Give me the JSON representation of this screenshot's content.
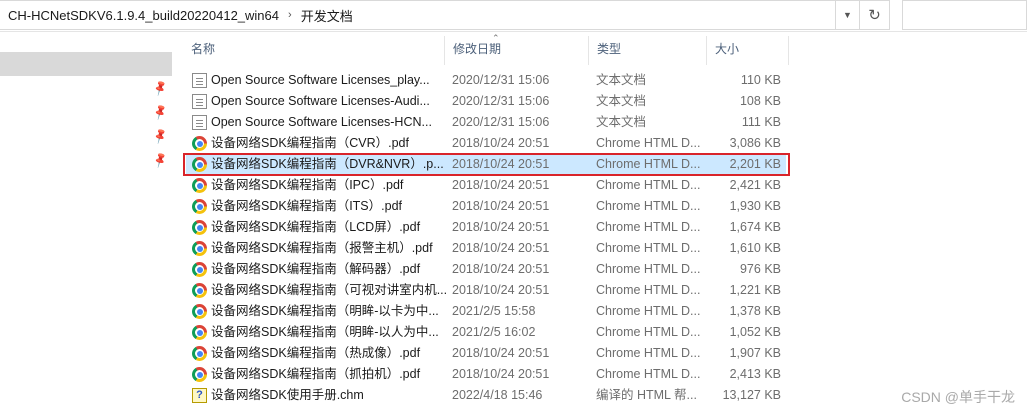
{
  "address": {
    "crumbs": [
      "CH-HCNetSDKV6.1.9.4_build20220412_win64",
      "开发文档"
    ],
    "separator": "›",
    "dropdown_icon": "chevron-down-icon",
    "refresh_icon": "refresh-icon"
  },
  "columns": {
    "name": "名称",
    "date": "修改日期",
    "type": "类型",
    "size": "大小"
  },
  "files": [
    {
      "name": "Open Source Software Licenses_play...",
      "date": "2020/12/31 15:06",
      "type": "文本文档",
      "size": "110 KB",
      "icon": "document-icon"
    },
    {
      "name": "Open Source Software Licenses-Audi...",
      "date": "2020/12/31 15:06",
      "type": "文本文档",
      "size": "108 KB",
      "icon": "document-icon"
    },
    {
      "name": "Open Source Software Licenses-HCN...",
      "date": "2020/12/31 15:06",
      "type": "文本文档",
      "size": "111 KB",
      "icon": "document-icon"
    },
    {
      "name": "设备网络SDK编程指南（CVR）.pdf",
      "date": "2018/10/24 20:51",
      "type": "Chrome HTML D...",
      "size": "3,086 KB",
      "icon": "chrome-icon"
    },
    {
      "name": "设备网络SDK编程指南（DVR&NVR）.p...",
      "date": "2018/10/24 20:51",
      "type": "Chrome HTML D...",
      "size": "2,201 KB",
      "icon": "chrome-icon",
      "selected": true
    },
    {
      "name": "设备网络SDK编程指南（IPC）.pdf",
      "date": "2018/10/24 20:51",
      "type": "Chrome HTML D...",
      "size": "2,421 KB",
      "icon": "chrome-icon"
    },
    {
      "name": "设备网络SDK编程指南（ITS）.pdf",
      "date": "2018/10/24 20:51",
      "type": "Chrome HTML D...",
      "size": "1,930 KB",
      "icon": "chrome-icon"
    },
    {
      "name": "设备网络SDK编程指南（LCD屏）.pdf",
      "date": "2018/10/24 20:51",
      "type": "Chrome HTML D...",
      "size": "1,674 KB",
      "icon": "chrome-icon"
    },
    {
      "name": "设备网络SDK编程指南（报警主机）.pdf",
      "date": "2018/10/24 20:51",
      "type": "Chrome HTML D...",
      "size": "1,610 KB",
      "icon": "chrome-icon"
    },
    {
      "name": "设备网络SDK编程指南（解码器）.pdf",
      "date": "2018/10/24 20:51",
      "type": "Chrome HTML D...",
      "size": "976 KB",
      "icon": "chrome-icon"
    },
    {
      "name": "设备网络SDK编程指南（可视对讲室内机...",
      "date": "2018/10/24 20:51",
      "type": "Chrome HTML D...",
      "size": "1,221 KB",
      "icon": "chrome-icon"
    },
    {
      "name": "设备网络SDK编程指南（明眸-以卡为中...",
      "date": "2021/2/5 15:58",
      "type": "Chrome HTML D...",
      "size": "1,378 KB",
      "icon": "chrome-icon"
    },
    {
      "name": "设备网络SDK编程指南（明眸-以人为中...",
      "date": "2021/2/5 16:02",
      "type": "Chrome HTML D...",
      "size": "1,052 KB",
      "icon": "chrome-icon"
    },
    {
      "name": "设备网络SDK编程指南（热成像）.pdf",
      "date": "2018/10/24 20:51",
      "type": "Chrome HTML D...",
      "size": "1,907 KB",
      "icon": "chrome-icon"
    },
    {
      "name": "设备网络SDK编程指南（抓拍机）.pdf",
      "date": "2018/10/24 20:51",
      "type": "Chrome HTML D...",
      "size": "2,413 KB",
      "icon": "chrome-icon"
    },
    {
      "name": "设备网络SDK使用手册.chm",
      "date": "2022/4/18 15:46",
      "type": "编译的 HTML 帮...",
      "size": "13,127 KB",
      "icon": "help-file-icon"
    }
  ],
  "watermark": "CSDN @单手干龙",
  "colors": {
    "selected_row": "#cce8ff",
    "highlight_border": "#d9242a",
    "header_text": "#4c607a"
  }
}
